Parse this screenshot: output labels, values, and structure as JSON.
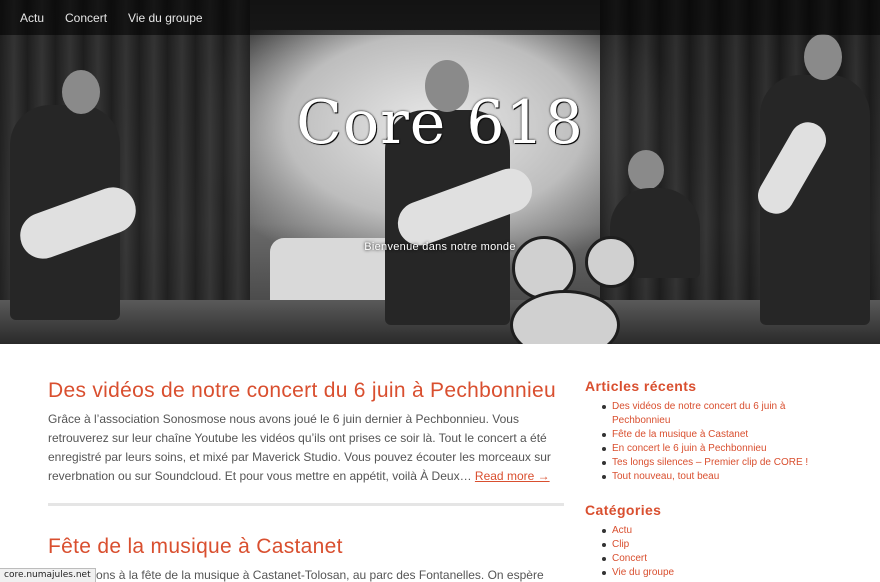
{
  "nav": {
    "items": [
      {
        "label": "Actu"
      },
      {
        "label": "Concert"
      },
      {
        "label": "Vie du groupe"
      }
    ]
  },
  "hero": {
    "title": "Core 618",
    "tagline": "Bienvenue dans notre monde"
  },
  "posts": [
    {
      "title": "Des vidéos de notre concert du 6 juin à Pechbonnieu",
      "excerpt": "Grâce à l’association Sonosmose nous avons joué le 6 juin dernier à Pechbonnieu. Vous retrouverez sur leur chaîne Youtube les vidéos qu’ils ont prises ce soir là. Tout le concert a été enregistré par leurs soins, et mixé par Maverick Studio. Vous pouvez écouter les morceaux sur reverbnation ou sur Soundcloud. Et pour vous mettre en appétit, voilà À Deux…",
      "read_more": "Read more →"
    },
    {
      "title": "Fête de la musique à Castanet",
      "excerpt": "Nous serons à la fête de la musique à Castanet-Tolosan, au parc des Fontanelles. On espère vous y"
    }
  ],
  "sidebar": {
    "recent": {
      "title": "Articles récents",
      "items": [
        "Des vidéos de notre concert du 6 juin à Pechbonnieu",
        "Fête de la musique à Castanet",
        "En concert le 6 juin à Pechbonnieu",
        "Tes longs silences – Premier clip de CORE !",
        "Tout nouveau, tout beau"
      ]
    },
    "categories": {
      "title": "Catégories",
      "items": [
        "Actu",
        "Clip",
        "Concert",
        "Vie du groupe"
      ]
    }
  },
  "status": {
    "url": "core.numajules.net"
  },
  "colors": {
    "accent": "#d94f2f",
    "nav_bg": "#000000"
  }
}
